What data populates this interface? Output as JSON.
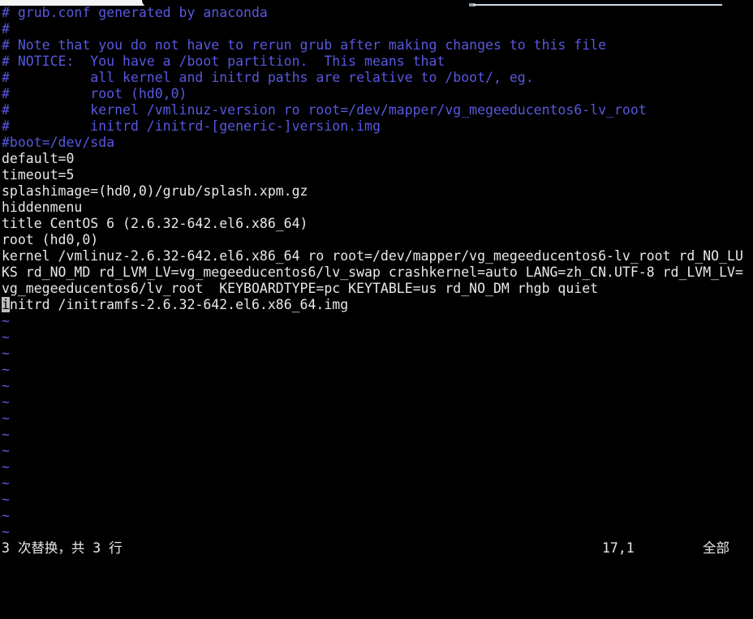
{
  "window": {
    "chrome": {
      "tab_plate_color": "#f4f4f4",
      "accent_line_color": "#cfdbe4",
      "background": "#000000"
    }
  },
  "terminal": {
    "background": "#000000",
    "foreground": "#e8e8e8",
    "comment_color": "#5858e0",
    "cursor_color": "#bdbdbd",
    "cursor_row": 17,
    "cursor_col": 1,
    "lines": [
      {
        "type": "comment",
        "text": "# grub.conf generated by anaconda"
      },
      {
        "type": "comment",
        "text": "#"
      },
      {
        "type": "comment",
        "text": "# Note that you do not have to rerun grub after making changes to this file"
      },
      {
        "type": "comment",
        "text": "# NOTICE:  You have a /boot partition.  This means that"
      },
      {
        "type": "comment",
        "text": "#          all kernel and initrd paths are relative to /boot/, eg."
      },
      {
        "type": "comment",
        "text": "#          root (hd0,0)"
      },
      {
        "type": "comment",
        "text": "#          kernel /vmlinuz-version ro root=/dev/mapper/vg_megeeducentos6-lv_root"
      },
      {
        "type": "comment",
        "text": "#          initrd /initrd-[generic-]version.img"
      },
      {
        "type": "comment",
        "text": "#boot=/dev/sda"
      },
      {
        "type": "plain",
        "text": "default=0"
      },
      {
        "type": "plain",
        "text": "timeout=5"
      },
      {
        "type": "plain",
        "text": "splashimage=(hd0,0)/grub/splash.xpm.gz"
      },
      {
        "type": "plain",
        "text": "hiddenmenu"
      },
      {
        "type": "plain",
        "text": "title CentOS 6 (2.6.32-642.el6.x86_64)"
      },
      {
        "type": "plain",
        "text": "root (hd0,0)"
      },
      {
        "type": "plain",
        "text": "kernel /vmlinuz-2.6.32-642.el6.x86_64 ro root=/dev/mapper/vg_megeeducentos6-lv_root rd_NO_LU"
      },
      {
        "type": "plain",
        "text": "KS rd_NO_MD rd_LVM_LV=vg_megeeducentos6/lv_swap crashkernel=auto LANG=zh_CN.UTF-8 rd_LVM_LV="
      },
      {
        "type": "plain",
        "text": "vg_megeeducentos6/lv_root  KEYBOARDTYPE=pc KEYTABLE=us rd_NO_DM rhgb quiet"
      }
    ],
    "cursor_line": {
      "head": "i",
      "tail": "nitrd /initramfs-2.6.32-642.el6.x86_64.img"
    },
    "empty_marker": "~",
    "empty_marker_count": 14
  },
  "statusline": {
    "message": "3 次替换，共 3 行",
    "position": "17,1",
    "scroll": "全部"
  }
}
